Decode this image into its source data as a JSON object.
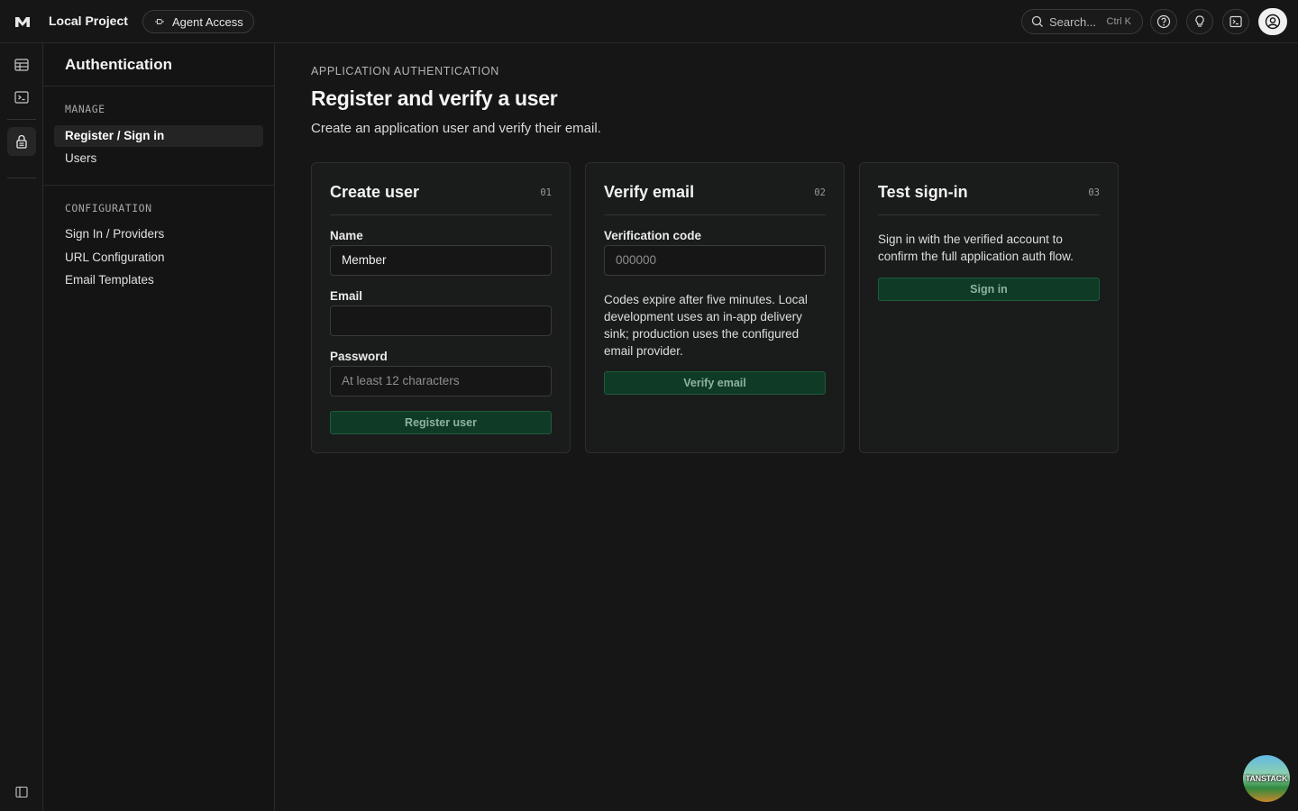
{
  "topbar": {
    "project_name": "Local Project",
    "agent_access_label": "Agent Access",
    "search_label": "Search...",
    "search_shortcut": "Ctrl K"
  },
  "sidebar": {
    "title": "Authentication",
    "manage_label": "MANAGE",
    "manage_items": [
      "Register / Sign in",
      "Users"
    ],
    "active_item": "Register / Sign in",
    "config_label": "CONFIGURATION",
    "config_items": [
      "Sign In / Providers",
      "URL Configuration",
      "Email Templates"
    ]
  },
  "main": {
    "eyebrow": "APPLICATION AUTHENTICATION",
    "title": "Register and verify a user",
    "subtitle": "Create an application user and verify their email.",
    "cards": [
      {
        "title": "Create user",
        "number": "01",
        "name_label": "Name",
        "name_value": "Member",
        "email_label": "Email",
        "email_value": "",
        "password_label": "Password",
        "password_placeholder": "At least 12 characters",
        "button_label": "Register user"
      },
      {
        "title": "Verify email",
        "number": "02",
        "code_label": "Verification code",
        "code_placeholder": "000000",
        "description": "Codes expire after five minutes. Local development uses an in-app delivery sink; production uses the configured email provider.",
        "button_label": "Verify email"
      },
      {
        "title": "Test sign-in",
        "number": "03",
        "description": "Sign in with the verified account to confirm the full application auth flow.",
        "button_label": "Sign in"
      }
    ]
  },
  "badge": {
    "label": "TANSTACK"
  },
  "colors": {
    "background": "#161616",
    "accent_button": "#0f3b26",
    "accent_button_text": "#8fb29f"
  }
}
